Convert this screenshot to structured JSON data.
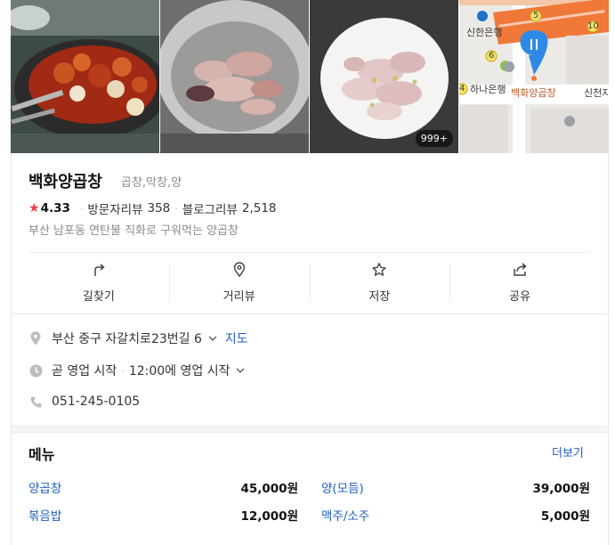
{
  "photos": [
    {
      "name": "photo-grill"
    },
    {
      "name": "photo-bowl"
    },
    {
      "name": "photo-plate",
      "badge": "999+"
    },
    {
      "name": "photo-map"
    }
  ],
  "map": {
    "labels": [
      "신한은행",
      "하나은행",
      "백화양곱창",
      "신천지"
    ],
    "exit_numbers": [
      "5",
      "10",
      "6",
      "4"
    ],
    "accent": "#f07838",
    "pin_color": "#2f8ae5"
  },
  "place": {
    "name": "백화양곱창",
    "category": "곱창,막창,양",
    "rating": "4.33",
    "visitor_review_label": "방문자리뷰",
    "visitor_review_count": "358",
    "blog_review_label": "블로그리뷰",
    "blog_review_count": "2,518",
    "description": "부산 남포동 연탄불 직화로 구워먹는 양곱창"
  },
  "actions": [
    {
      "label": "길찾기",
      "icon": "directions-icon"
    },
    {
      "label": "거리뷰",
      "icon": "street-view-icon"
    },
    {
      "label": "저장",
      "icon": "star-outline-icon"
    },
    {
      "label": "공유",
      "icon": "share-icon"
    }
  ],
  "details": {
    "address": "부산 중구 자갈치로23번길 6",
    "map_link": "지도",
    "status": "곧 영업 시작",
    "hours": "12:00에 영업 시작",
    "phone": "051-245-0105"
  },
  "menu": {
    "title": "메뉴",
    "more": "더보기",
    "items": [
      {
        "name": "양곱창",
        "price": "45,000원"
      },
      {
        "name": "양(모듬)",
        "price": "39,000원"
      },
      {
        "name": "볶음밥",
        "price": "12,000원"
      },
      {
        "name": "맥주/소주",
        "price": "5,000원"
      }
    ]
  },
  "colors": {
    "link": "#1f5fbf",
    "star": "#f23d3d"
  }
}
